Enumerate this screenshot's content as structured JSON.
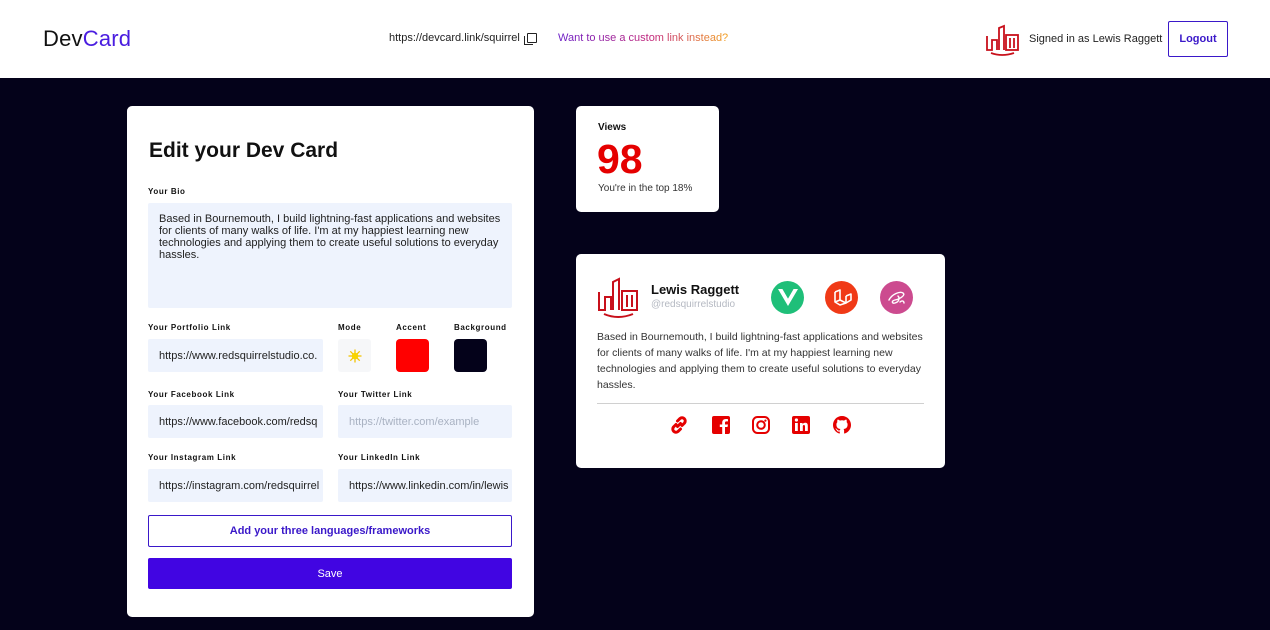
{
  "header": {
    "logo_dev": "Dev",
    "logo_card": "Card",
    "card_link": "https://devcard.link/squirrel",
    "custom_link_prompt": "Want to use a custom link instead?",
    "signed_in_text": "Signed in as Lewis Raggett",
    "logout_label": "Logout"
  },
  "edit": {
    "title": "Edit your Dev Card",
    "bio_label": "Your Bio",
    "bio_value": "Based in Bournemouth, I build lightning-fast applications and websites for clients of many walks of life. I'm at my happiest learning new technologies and applying them to create useful solutions to everyday hassles.",
    "portfolio_label": "Your Portfolio Link",
    "portfolio_value": "https://www.redsquirrelstudio.co.",
    "mode_label": "Mode",
    "accent_label": "Accent",
    "background_label": "Background",
    "facebook_label": "Your Facebook Link",
    "facebook_value": "https://www.facebook.com/redsq",
    "twitter_label": "Your Twitter Link",
    "twitter_placeholder": "https://twitter.com/example",
    "instagram_label": "Your Instagram Link",
    "instagram_value": "https://instagram.com/redsquirrel",
    "linkedin_label": "Your LinkedIn Link",
    "linkedin_value": "https://www.linkedin.com/in/lewis",
    "languages_button": "Add your three languages/frameworks",
    "save_button": "Save"
  },
  "colors": {
    "accent": "#ff0000",
    "background": "#04021a",
    "brand": "#4105e2"
  },
  "views": {
    "label": "Views",
    "count": "98",
    "rank_text": "You're in the top 18%"
  },
  "preview": {
    "name": "Lewis Raggett",
    "handle": "@redsquirrelstudio",
    "bio": "Based in Bournemouth, I build lightning-fast applications and websites for clients of many walks of life. I'm at my happiest learning new technologies and applying them to create useful solutions to everyday hassles.",
    "technologies": [
      "vue-icon",
      "laravel-icon",
      "sass-icon"
    ],
    "socials": [
      "link-icon",
      "facebook-icon",
      "instagram-icon",
      "linkedin-icon",
      "github-icon"
    ]
  }
}
